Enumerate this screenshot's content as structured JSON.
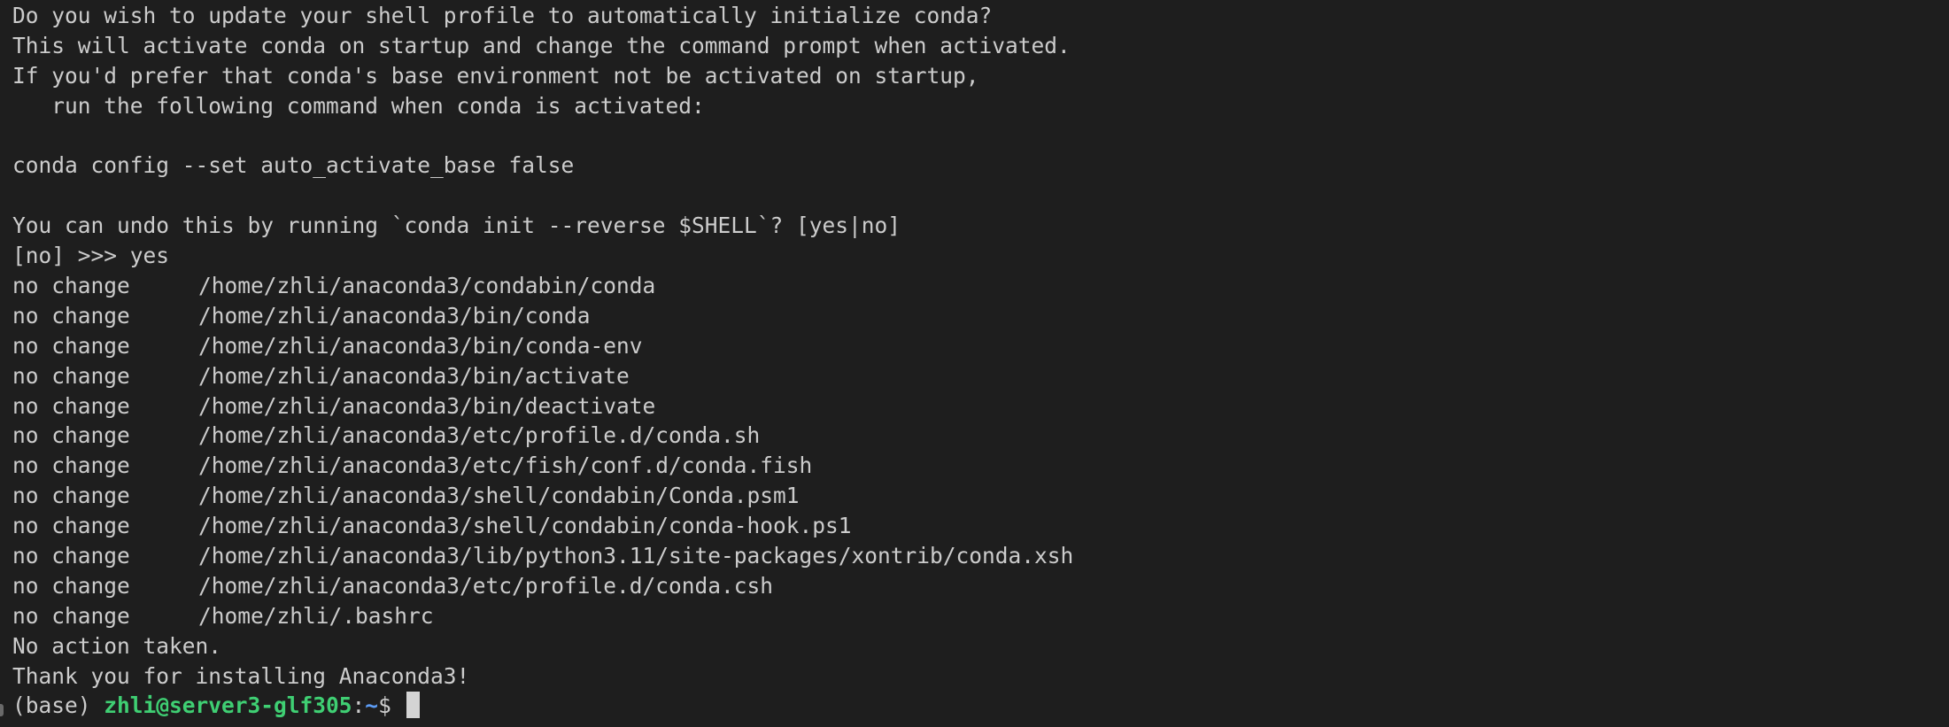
{
  "colors": {
    "background": "#1e1e1e",
    "foreground": "#cccccc",
    "prompt_user_host": "#3fcf73",
    "prompt_path": "#5c9cf5",
    "cursor": "#d4d4d4"
  },
  "intro_lines": [
    "Do you wish to update your shell profile to automatically initialize conda?",
    "This will activate conda on startup and change the command prompt when activated.",
    "If you'd prefer that conda's base environment not be activated on startup,",
    "   run the following command when conda is activated:",
    "",
    "conda config --set auto_activate_base false",
    "",
    "You can undo this by running `conda init --reverse $SHELL`? [yes|no]",
    "[no] >>> yes"
  ],
  "changes": [
    {
      "status": "no change",
      "path": "/home/zhli/anaconda3/condabin/conda"
    },
    {
      "status": "no change",
      "path": "/home/zhli/anaconda3/bin/conda"
    },
    {
      "status": "no change",
      "path": "/home/zhli/anaconda3/bin/conda-env"
    },
    {
      "status": "no change",
      "path": "/home/zhli/anaconda3/bin/activate"
    },
    {
      "status": "no change",
      "path": "/home/zhli/anaconda3/bin/deactivate"
    },
    {
      "status": "no change",
      "path": "/home/zhli/anaconda3/etc/profile.d/conda.sh"
    },
    {
      "status": "no change",
      "path": "/home/zhli/anaconda3/etc/fish/conf.d/conda.fish"
    },
    {
      "status": "no change",
      "path": "/home/zhli/anaconda3/shell/condabin/Conda.psm1"
    },
    {
      "status": "no change",
      "path": "/home/zhli/anaconda3/shell/condabin/conda-hook.ps1"
    },
    {
      "status": "no change",
      "path": "/home/zhli/anaconda3/lib/python3.11/site-packages/xontrib/conda.xsh"
    },
    {
      "status": "no change",
      "path": "/home/zhli/anaconda3/etc/profile.d/conda.csh"
    },
    {
      "status": "no change",
      "path": "/home/zhli/.bashrc"
    }
  ],
  "outro_lines": [
    "No action taken.",
    "Thank you for installing Anaconda3!"
  ],
  "prompt": {
    "env": "(base) ",
    "user_host": "zhli@server3-glf305",
    "separator": ":",
    "cwd": "~",
    "symbol": "$ "
  }
}
